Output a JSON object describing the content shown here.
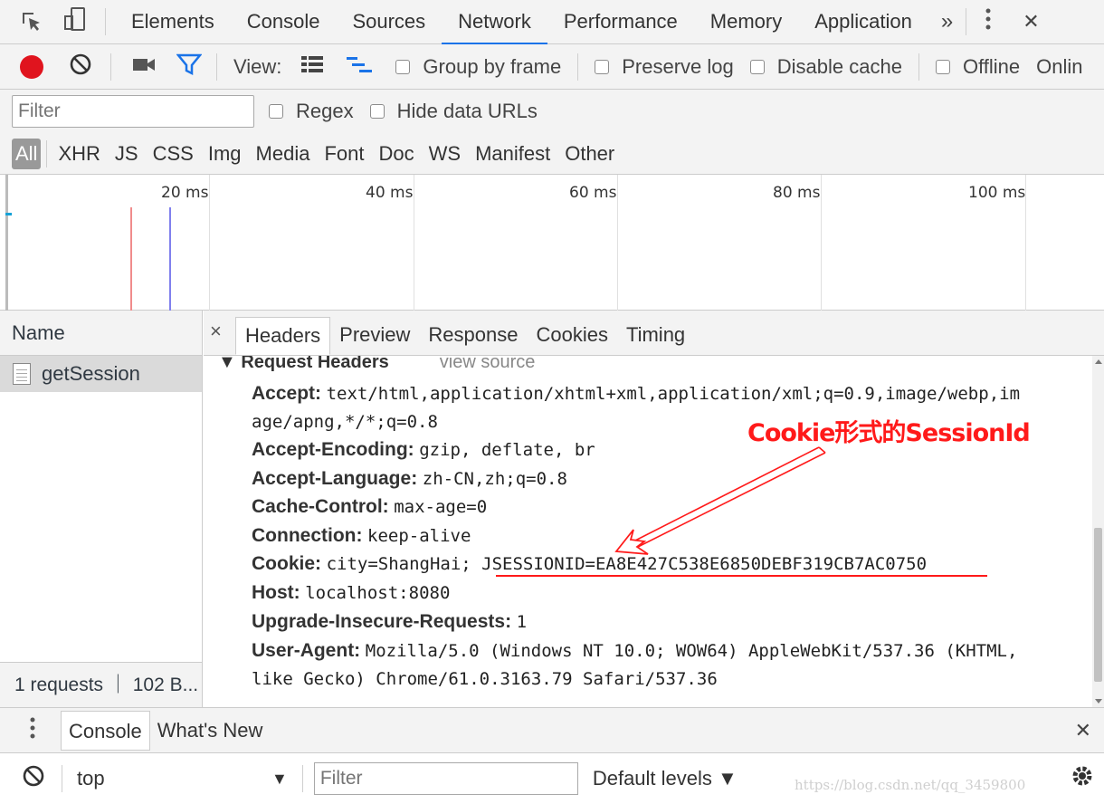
{
  "tabs": {
    "items": [
      "Elements",
      "Console",
      "Sources",
      "Network",
      "Performance",
      "Memory",
      "Application"
    ],
    "active": "Network",
    "more": "»",
    "close": "✕"
  },
  "toolbar": {
    "view_label": "View:",
    "group_by_frame": "Group by frame",
    "preserve_log": "Preserve log",
    "disable_cache": "Disable cache",
    "offline": "Offline",
    "online": "Onlin"
  },
  "filter": {
    "placeholder": "Filter",
    "regex": "Regex",
    "hide_data_urls": "Hide data URLs"
  },
  "types": [
    "All",
    "XHR",
    "JS",
    "CSS",
    "Img",
    "Media",
    "Font",
    "Doc",
    "WS",
    "Manifest",
    "Other"
  ],
  "overview": {
    "ticks": [
      "20 ms",
      "40 ms",
      "60 ms",
      "80 ms",
      "100 ms"
    ]
  },
  "name_panel": {
    "header": "Name",
    "request": "getSession",
    "summary": "1 requests ｜ 102 B..."
  },
  "detail_tabs": {
    "close": "×",
    "items": [
      "Headers",
      "Preview",
      "Response",
      "Cookies",
      "Timing"
    ],
    "active": "Headers"
  },
  "request_headers": {
    "title": "▼ Request Headers",
    "view_source": "view source",
    "lines": [
      {
        "key": "Accept:",
        "value": "text/html,application/xhtml+xml,application/xml;q=0.9,image/webp,im"
      },
      {
        "key": "",
        "value": "age/apng,*/*;q=0.8"
      },
      {
        "key": "Accept-Encoding:",
        "value": "gzip, deflate, br"
      },
      {
        "key": "Accept-Language:",
        "value": "zh-CN,zh;q=0.8"
      },
      {
        "key": "Cache-Control:",
        "value": "max-age=0"
      },
      {
        "key": "Connection:",
        "value": "keep-alive"
      },
      {
        "key": "Cookie:",
        "value": "city=ShangHai; JSESSIONID=EA8E427C538E6850DEBF319CB7AC0750"
      },
      {
        "key": "Host:",
        "value": "localhost:8080"
      },
      {
        "key": "Upgrade-Insecure-Requests:",
        "value": "1"
      },
      {
        "key": "User-Agent:",
        "value": "Mozilla/5.0 (Windows NT 10.0; WOW64) AppleWebKit/537.36 (KHTML,"
      },
      {
        "key": "",
        "value": "like Gecko) Chrome/61.0.3163.79 Safari/537.36"
      }
    ]
  },
  "annotation": {
    "text": "Cookie形式的SessionId",
    "color": "#ff1a1a"
  },
  "drawer": {
    "tabs": [
      "Console",
      "What's New"
    ],
    "close": "✕"
  },
  "console_bar": {
    "context": "top",
    "filter_placeholder": "Filter",
    "levels": "Default levels ▼"
  },
  "watermark": "https://blog.csdn.net/qq_3459800",
  "colors": {
    "record": "#e0141e",
    "accent": "#1a73e8",
    "filter_icon": "#1a73e8"
  }
}
